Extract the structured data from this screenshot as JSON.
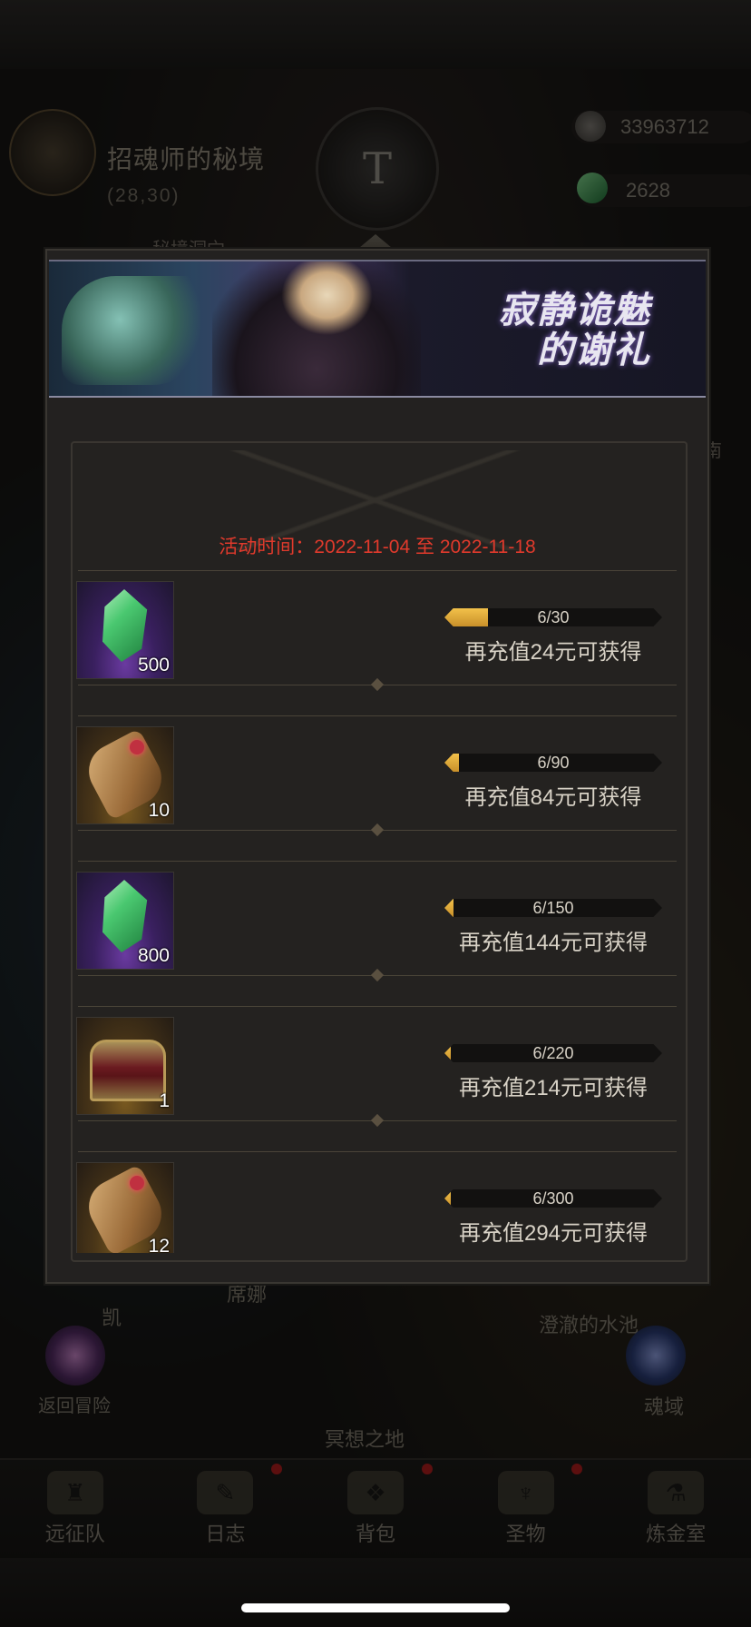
{
  "background": {
    "map": {
      "title": "招魂师的秘境",
      "coordinates": "(28,30)",
      "sub_label": "秘境洞穴"
    },
    "resources": [
      {
        "icon": "dark-stone-icon",
        "value": "33963712"
      },
      {
        "icon": "green-gem-icon",
        "value": "2628"
      }
    ],
    "side_labels": [
      "南",
      "凯",
      "席娜",
      "澄澈的水池",
      "冥想之地"
    ],
    "left_portal_label": "返回冒险",
    "right_portal_label": "魂域"
  },
  "modal": {
    "banner": {
      "title_line1": "寂静诡魅",
      "title_line2": "的谢礼"
    },
    "event_time": "活动时间：2022-11-04 至 2022-11-18",
    "rewards": [
      {
        "icon": "green-gem-icon",
        "count": "500",
        "progress_text": "6/30",
        "progress": 0.2,
        "hint": "再充值24元可获得"
      },
      {
        "icon": "scroll-icon",
        "count": "10",
        "progress_text": "6/90",
        "progress": 0.0667,
        "hint": "再充值84元可获得"
      },
      {
        "icon": "green-gem-icon",
        "count": "800",
        "progress_text": "6/150",
        "progress": 0.04,
        "hint": "再充值144元可获得"
      },
      {
        "icon": "treasure-chest-icon",
        "count": "1",
        "progress_text": "6/220",
        "progress": 0.0273,
        "hint": "再充值214元可获得"
      },
      {
        "icon": "scroll-icon",
        "count": "12",
        "progress_text": "6/300",
        "progress": 0.02,
        "hint": "再充值294元可获得"
      }
    ]
  },
  "bottom_nav": [
    {
      "icon": "helmet-icon",
      "label": "远征队",
      "badge": false
    },
    {
      "icon": "journal-icon",
      "label": "日志",
      "badge": true
    },
    {
      "icon": "backpack-icon",
      "label": "背包",
      "badge": true
    },
    {
      "icon": "relic-icon",
      "label": "圣物",
      "badge": true
    },
    {
      "icon": "alchemy-icon",
      "label": "炼金室",
      "badge": false
    }
  ]
}
